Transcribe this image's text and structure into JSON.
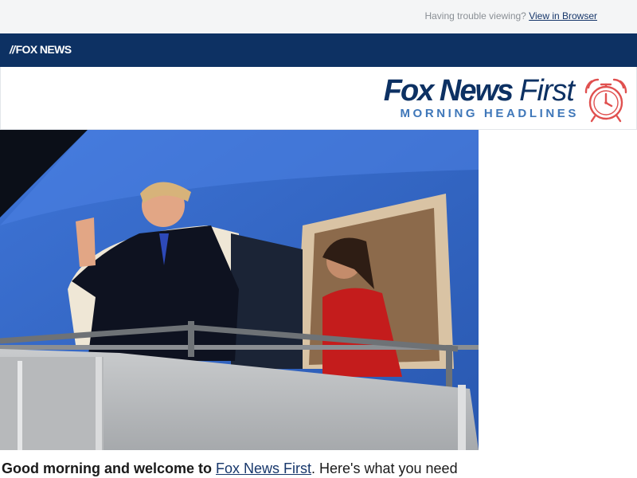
{
  "preheader": {
    "trouble_text": "Having trouble viewing?",
    "view_link": "View in Browser"
  },
  "brand": {
    "logo_text": "FOX NEWS",
    "bar_color": "#0d3163"
  },
  "masthead": {
    "title_bold": "Fox News",
    "title_light": "First",
    "subtitle": "MORNING HEADLINES",
    "clock_icon": "alarm-clock-icon",
    "clock_color": "#e0504f"
  },
  "hero_image": {
    "icon": "photo-icon"
  },
  "intro": {
    "greeting": "Good morning and welcome to ",
    "link_text": "Fox News First",
    "tail": ". Here's what you need"
  }
}
